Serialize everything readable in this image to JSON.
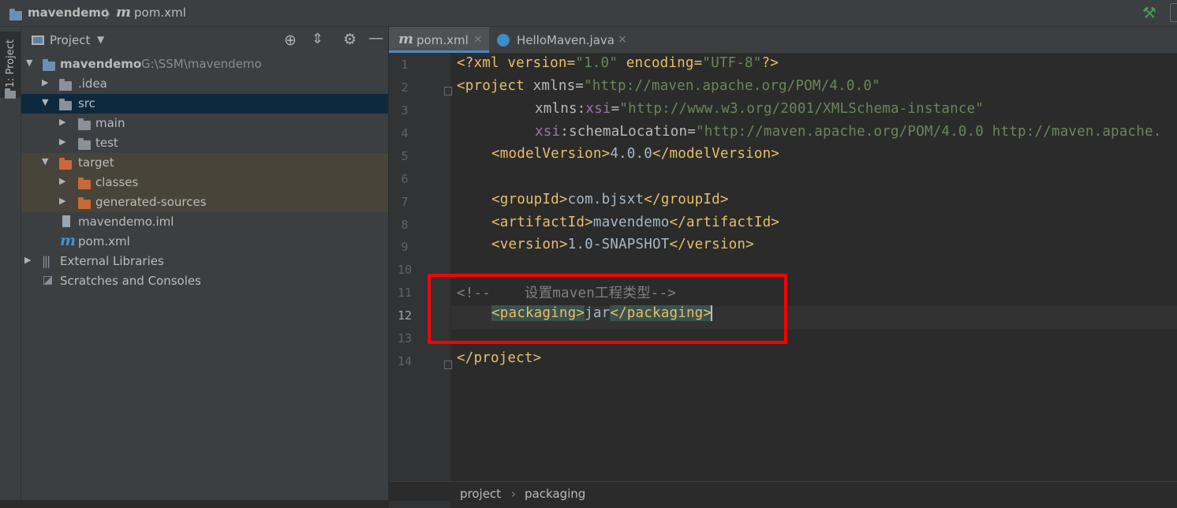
{
  "breadcrumb": {
    "project": "mavendemo",
    "sep": "〉",
    "file": "pom.xml"
  },
  "toolstrip": {
    "project_tab": "1: Project"
  },
  "project_panel": {
    "title": "Project",
    "tree": [
      {
        "label": "mavendemo",
        "extra": "G:\\SSM\\mavendemo"
      },
      {
        "label": ".idea"
      },
      {
        "label": "src"
      },
      {
        "label": "main"
      },
      {
        "label": "test"
      },
      {
        "label": "target"
      },
      {
        "label": "classes"
      },
      {
        "label": "generated-sources"
      },
      {
        "label": "mavendemo.iml"
      },
      {
        "label": "pom.xml"
      },
      {
        "label": "External Libraries"
      },
      {
        "label": "Scratches and Consoles"
      }
    ]
  },
  "editor": {
    "tabs": [
      {
        "label": "pom.xml",
        "close": "×"
      },
      {
        "label": "HelloMaven.java",
        "close": "×"
      }
    ],
    "line_numbers": [
      "1",
      "2",
      "3",
      "4",
      "5",
      "6",
      "7",
      "8",
      "9",
      "10",
      "11",
      "12",
      "13",
      "14"
    ],
    "code": {
      "l1": {
        "a": "<?xml version=",
        "b": "\"1.0\"",
        "c": " encoding=",
        "d": "\"UTF-8\"",
        "e": "?>"
      },
      "l2": {
        "a": "<project",
        "b": " xmlns=",
        "c": "\"http://maven.apache.org/POM/4.0.0\""
      },
      "l3": {
        "a": "xmlns:",
        "b": "xsi",
        "c": "=",
        "d": "\"http://www.w3.org/2001/XMLSchema-instance\""
      },
      "l4": {
        "a": "xsi",
        "b": ":schemaLocation=",
        "c": "\"http://maven.apache.org/POM/4.0.0 http://maven.apache."
      },
      "l5": {
        "a": "<modelVersion>",
        "b": "4.0.0",
        "c": "</modelVersion>"
      },
      "l7": {
        "a": "<groupId>",
        "b": "com.bjsxt",
        "c": "</groupId>"
      },
      "l8": {
        "a": "<artifactId>",
        "b": "mavendemo",
        "c": "</artifactId>"
      },
      "l9": {
        "a": "<version>",
        "b": "1.0-SNAPSHOT",
        "c": "</version>"
      },
      "l11": {
        "a": "<!--    设置maven工程类型-->"
      },
      "l12": {
        "a": "<packaging>",
        "b": "jar",
        "c": "</packaging>"
      },
      "l14": {
        "a": "</project>"
      }
    },
    "status_breadcrumb": {
      "a": "project",
      "sep": "›",
      "b": "packaging"
    }
  },
  "colors": {
    "annotation_box": "#ff0000",
    "tab_underline": "#4a88c7",
    "tag": "#e8bf6a",
    "string": "#6a8759"
  }
}
